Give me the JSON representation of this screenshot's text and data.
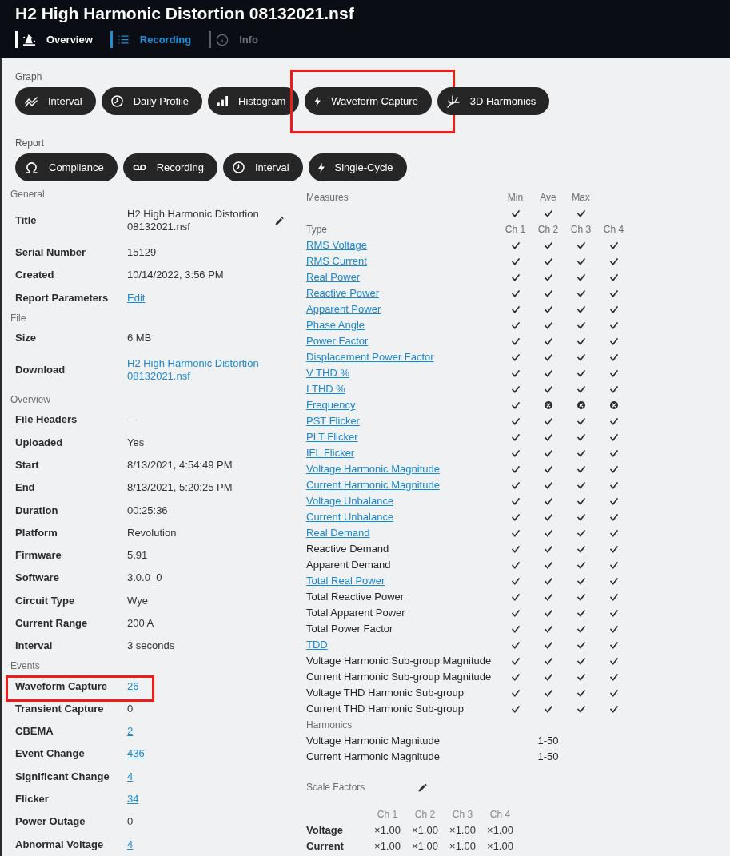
{
  "header": {
    "title": "H2 High Harmonic Distortion 08132021.nsf",
    "tabs": [
      {
        "label": "Overview",
        "selected": true,
        "disabled": false
      },
      {
        "label": "Recording",
        "selected": false,
        "disabled": false
      },
      {
        "label": "Info",
        "selected": false,
        "disabled": true
      }
    ]
  },
  "graph": {
    "label": "Graph",
    "buttons": [
      {
        "label": "Interval",
        "highlighted": false
      },
      {
        "label": "Daily Profile",
        "highlighted": false
      },
      {
        "label": "Histogram",
        "highlighted": false
      },
      {
        "label": "Waveform Capture",
        "highlighted": true
      },
      {
        "label": "3D Harmonics",
        "highlighted": false
      }
    ]
  },
  "report": {
    "label": "Report",
    "buttons": [
      {
        "label": "Compliance"
      },
      {
        "label": "Recording"
      },
      {
        "label": "Interval"
      },
      {
        "label": "Single-Cycle"
      }
    ]
  },
  "details": [
    {
      "heading": "General",
      "rows": [
        {
          "label": "Title",
          "value": "H2 High Harmonic Distortion 08132021.nsf",
          "kind": "editable"
        },
        {
          "label": "Serial Number",
          "value": "15129",
          "kind": "text"
        },
        {
          "label": "Created",
          "value": "10/14/2022, 3:56 PM",
          "kind": "text"
        },
        {
          "label": "Report Parameters",
          "value": "Edit",
          "kind": "link"
        }
      ]
    },
    {
      "heading": "File",
      "rows": [
        {
          "label": "Size",
          "value": "6 MB",
          "kind": "text"
        },
        {
          "label": "Download",
          "value": "H2 High Harmonic Distortion 08132021.nsf",
          "kind": "download"
        }
      ]
    },
    {
      "heading": "Overview",
      "rows": [
        {
          "label": "File Headers",
          "value": "—",
          "kind": "muted"
        },
        {
          "label": "Uploaded",
          "value": "Yes",
          "kind": "text"
        },
        {
          "label": "Start",
          "value": "8/13/2021, 4:54:49 PM",
          "kind": "text"
        },
        {
          "label": "End",
          "value": "8/13/2021, 5:20:25 PM",
          "kind": "text"
        },
        {
          "label": "Duration",
          "value": "00:25:36",
          "kind": "text"
        },
        {
          "label": "Platform",
          "value": "Revolution",
          "kind": "text"
        },
        {
          "label": "Firmware",
          "value": "5.91",
          "kind": "text"
        },
        {
          "label": "Software",
          "value": "3.0.0_0",
          "kind": "text"
        },
        {
          "label": "Circuit Type",
          "value": "Wye",
          "kind": "text"
        },
        {
          "label": "Current Range",
          "value": "200 A",
          "kind": "text"
        },
        {
          "label": "Interval",
          "value": "3 seconds",
          "kind": "text"
        }
      ]
    },
    {
      "heading": "Events",
      "rows": [
        {
          "label": "Waveform Capture",
          "value": "26",
          "kind": "link",
          "highlighted": true
        },
        {
          "label": "Transient Capture",
          "value": "0",
          "kind": "text",
          "highlighted": false
        },
        {
          "label": "CBEMA",
          "value": "2",
          "kind": "link",
          "highlighted": false
        },
        {
          "label": "Event Change",
          "value": "436",
          "kind": "link",
          "highlighted": false
        },
        {
          "label": "Significant Change",
          "value": "4",
          "kind": "link",
          "highlighted": false
        },
        {
          "label": "Flicker",
          "value": "34",
          "kind": "link",
          "highlighted": false
        },
        {
          "label": "Power Outage",
          "value": "0",
          "kind": "text",
          "highlighted": false
        },
        {
          "label": "Abnormal Voltage",
          "value": "4",
          "kind": "link",
          "highlighted": false
        }
      ]
    }
  ],
  "measures": {
    "label": "Measures",
    "stats": [
      {
        "label": "Min",
        "checked": true
      },
      {
        "label": "Ave",
        "checked": true
      },
      {
        "label": "Max",
        "checked": true
      }
    ],
    "type_label": "Type",
    "channels": [
      "Ch 1",
      "Ch 2",
      "Ch 3",
      "Ch 4"
    ],
    "rows": [
      {
        "name": "RMS Voltage",
        "link": true,
        "ch": [
          true,
          true,
          true,
          true
        ]
      },
      {
        "name": "RMS Current",
        "link": true,
        "ch": [
          true,
          true,
          true,
          true
        ]
      },
      {
        "name": "Real Power",
        "link": true,
        "ch": [
          true,
          true,
          true,
          true
        ]
      },
      {
        "name": "Reactive Power",
        "link": true,
        "ch": [
          true,
          true,
          true,
          true
        ]
      },
      {
        "name": "Apparent Power",
        "link": true,
        "ch": [
          true,
          true,
          true,
          true
        ]
      },
      {
        "name": "Phase Angle",
        "link": true,
        "ch": [
          true,
          true,
          true,
          true
        ]
      },
      {
        "name": "Power Factor",
        "link": true,
        "ch": [
          true,
          true,
          true,
          true
        ]
      },
      {
        "name": "Displacement Power Factor",
        "link": true,
        "ch": [
          true,
          true,
          true,
          true
        ]
      },
      {
        "name": "V THD %",
        "link": true,
        "ch": [
          true,
          true,
          true,
          true
        ]
      },
      {
        "name": "I THD %",
        "link": true,
        "ch": [
          true,
          true,
          true,
          true
        ]
      },
      {
        "name": "Frequency",
        "link": true,
        "ch": [
          true,
          false,
          false,
          false
        ]
      },
      {
        "name": "PST Flicker",
        "link": true,
        "ch": [
          true,
          true,
          true,
          true
        ]
      },
      {
        "name": "PLT Flicker",
        "link": true,
        "ch": [
          true,
          true,
          true,
          true
        ]
      },
      {
        "name": "IFL Flicker",
        "link": true,
        "ch": [
          true,
          true,
          true,
          true
        ]
      },
      {
        "name": "Voltage Harmonic Magnitude",
        "link": true,
        "ch": [
          true,
          true,
          true,
          true
        ]
      },
      {
        "name": "Current Harmonic Magnitude",
        "link": true,
        "ch": [
          true,
          true,
          true,
          true
        ]
      },
      {
        "name": "Voltage Unbalance",
        "link": true,
        "ch": [
          true,
          true,
          true,
          true
        ]
      },
      {
        "name": "Current Unbalance",
        "link": true,
        "ch": [
          true,
          true,
          true,
          true
        ]
      },
      {
        "name": "Real Demand",
        "link": true,
        "ch": [
          true,
          true,
          true,
          true
        ]
      },
      {
        "name": "Reactive Demand",
        "link": false,
        "ch": [
          true,
          true,
          true,
          true
        ]
      },
      {
        "name": "Apparent Demand",
        "link": false,
        "ch": [
          true,
          true,
          true,
          true
        ]
      },
      {
        "name": "Total Real Power",
        "link": true,
        "ch": [
          true,
          true,
          true,
          true
        ]
      },
      {
        "name": "Total Reactive Power",
        "link": false,
        "ch": [
          true,
          true,
          true,
          true
        ]
      },
      {
        "name": "Total Apparent Power",
        "link": false,
        "ch": [
          true,
          true,
          true,
          true
        ]
      },
      {
        "name": "Total Power Factor",
        "link": false,
        "ch": [
          true,
          true,
          true,
          true
        ]
      },
      {
        "name": "TDD",
        "link": true,
        "ch": [
          true,
          true,
          true,
          true
        ]
      },
      {
        "name": "Voltage Harmonic Sub-group Magnitude",
        "link": false,
        "ch": [
          true,
          true,
          true,
          true
        ]
      },
      {
        "name": "Current Harmonic Sub-group Magnitude",
        "link": false,
        "ch": [
          true,
          true,
          true,
          true
        ]
      },
      {
        "name": "Voltage THD Harmonic Sub-group",
        "link": false,
        "ch": [
          true,
          true,
          true,
          true
        ]
      },
      {
        "name": "Current THD Harmonic Sub-group",
        "link": false,
        "ch": [
          true,
          true,
          true,
          true
        ]
      }
    ]
  },
  "harmonics": {
    "heading": "Harmonics",
    "rows": [
      {
        "name": "Voltage Harmonic Magnitude",
        "range": "1-50"
      },
      {
        "name": "Current Harmonic Magnitude",
        "range": "1-50"
      }
    ]
  },
  "scale_factors": {
    "heading": "Scale Factors",
    "channels": [
      "Ch 1",
      "Ch 2",
      "Ch 3",
      "Ch 4"
    ],
    "rows": [
      {
        "label": "Voltage",
        "values": [
          "×1.00",
          "×1.00",
          "×1.00",
          "×1.00"
        ]
      },
      {
        "label": "Current",
        "values": [
          "×1.00",
          "×1.00",
          "×1.00",
          "×1.00"
        ]
      }
    ]
  }
}
